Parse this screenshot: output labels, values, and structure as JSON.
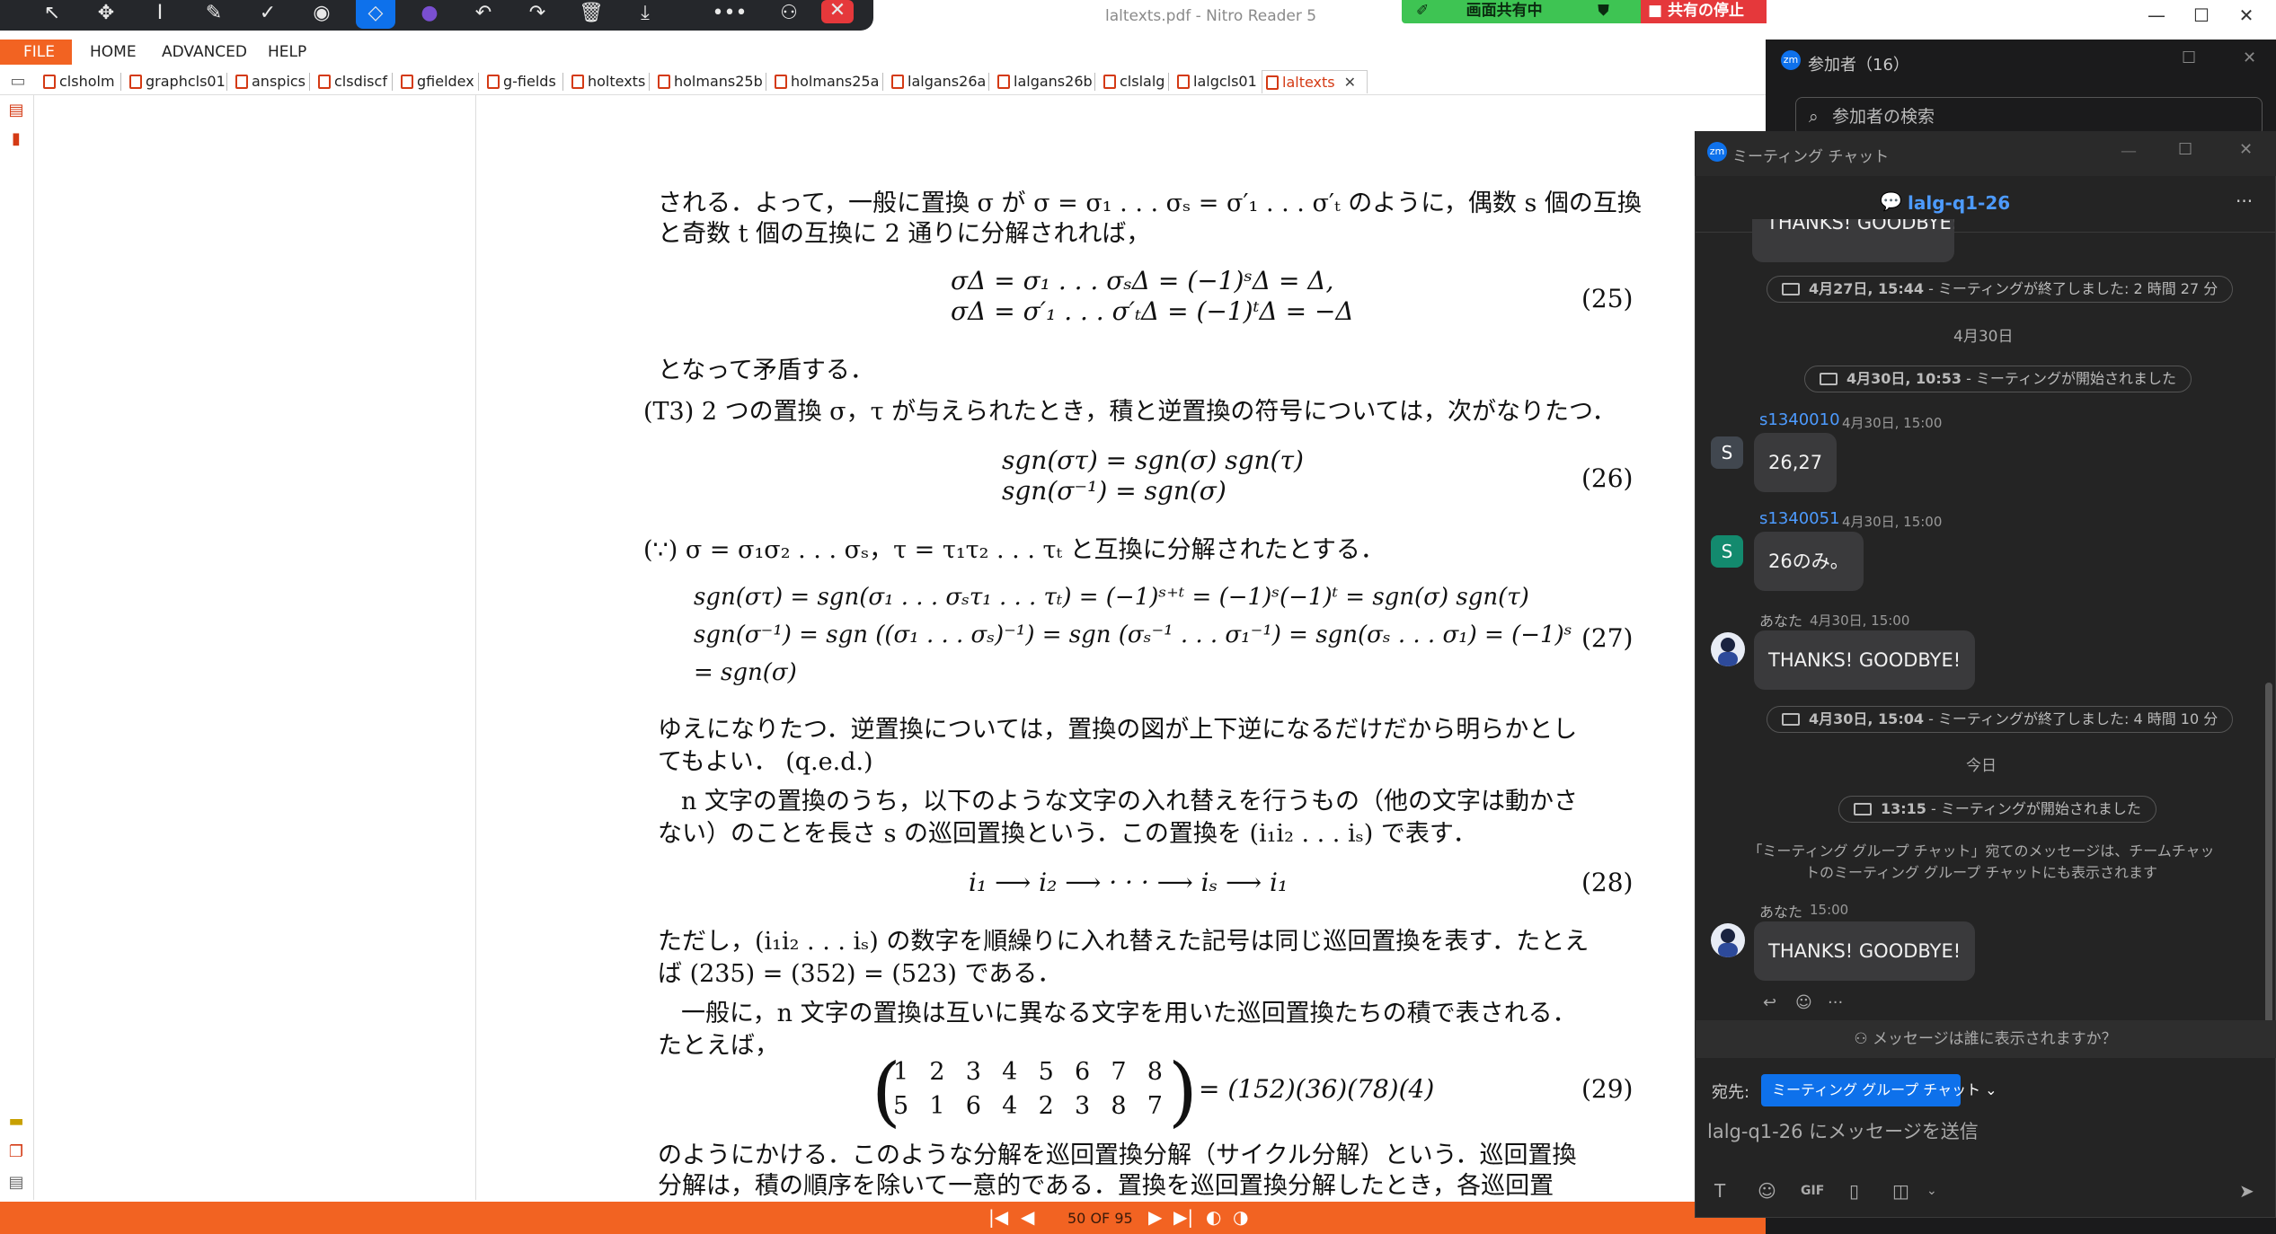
{
  "window": {
    "title": "laltexts.pdf - Nitro Reader 5",
    "minimize": "—",
    "maximize": "☐",
    "close": "✕"
  },
  "share_bar": {
    "label": "画面共有中",
    "stop_label": "共有の停止"
  },
  "menu": {
    "file": "FILE",
    "items": [
      "HOME",
      "ADVANCED",
      "HELP"
    ]
  },
  "tabs": [
    "clsholm",
    "graphcls01",
    "anspics",
    "clsdiscf",
    "gfieldex",
    "g-fields",
    "holtexts",
    "holmans25b",
    "holmans25a",
    "lalgans26a",
    "lalgans26b",
    "clslalg",
    "lalgcls01",
    "laltexts"
  ],
  "tab_close": "✕",
  "document": {
    "lines": [
      "される．よって，一般に置換 σ が σ = σ₁ . . . σₛ = σ′₁ . . . σ′ₜ のように，偶数 s 個の互換",
      "と奇数 t 個の互換に 2 通りに分解されれば，",
      "となって矛盾する．",
      "(T3)  2 つの置換 σ，τ が与えられたとき，積と逆置換の符号については，次がなりたつ．",
      "(∵)  σ = σ₁σ₂ . . . σₛ，τ = τ₁τ₂ . . . τₜ と互換に分解されたとする．",
      "ゆえになりたつ．逆置換については，置換の図が上下逆になるだけだから明らかとし",
      "てもよい．  (q.e.d.)",
      "n 文字の置換のうち，以下のような文字の入れ替えを行うもの（他の文字は動かさ",
      "ない）のことを長さ s の巡回置換という．この置換を (i₁i₂ . . . iₛ) で表す．",
      "ただし，(i₁i₂ . . . iₛ) の数字を順繰りに入れ替えた記号は同じ巡回置換を表す．たとえ",
      "ば (235) = (352) = (523) である．",
      "一般に，n 文字の置換は互いに異なる文字を用いた巡回置換たちの積で表される．",
      "たとえば，",
      "のようにかける．このような分解を巡回置換分解（サイクル分解）という．巡回置換",
      "分解は，積の順序を除いて一意的である．置換を巡回置換分解したとき，各巡回置"
    ],
    "equations": [
      "σΔ = σ₁ . . . σₛΔ = (−1)ˢΔ = Δ,",
      "σΔ = σ′₁ . . . σ′ₜΔ = (−1)ᵗΔ = −Δ",
      "sgn(στ) = sgn(σ) sgn(τ)",
      "sgn(σ⁻¹) = sgn(σ)",
      "sgn(στ) = sgn(σ₁ . . . σₛτ₁ . . . τₜ) = (−1)ˢ⁺ᵗ = (−1)ˢ(−1)ᵗ = sgn(σ) sgn(τ)",
      "sgn(σ⁻¹) = sgn ((σ₁ . . . σₛ)⁻¹) = sgn (σₛ⁻¹ . . . σ₁⁻¹) = sgn(σₛ . . . σ₁) = (−1)ˢ",
      "= sgn(σ)",
      "i₁ ⟶ i₂ ⟶ · · · ⟶ iₛ ⟶ i₁",
      "= (152)(36)(78)(4)"
    ],
    "matrix_top": [
      "1",
      "2",
      "3",
      "4",
      "5",
      "6",
      "7",
      "8"
    ],
    "matrix_bottom": [
      "5",
      "1",
      "6",
      "4",
      "2",
      "3",
      "8",
      "7"
    ],
    "eq_numbers": [
      "(25)",
      "(26)",
      "(27)",
      "(28)",
      "(29)"
    ]
  },
  "status": {
    "page": "50 OF 95"
  },
  "participants": {
    "title": "参加者（16）",
    "search_placeholder": "参加者の検索"
  },
  "chat": {
    "window_title": "ミーティング チャット",
    "name": "lalg-q1-26",
    "cut_message": "THANKS! GOODBYE!",
    "sys1_bold": "4月27日, 15:44",
    "sys1_text": " - ミーティングが終了しました: 2 時間 27 分",
    "date1": "4月30日",
    "sys2_bold": "4月30日, 10:53",
    "sys2_text": " - ミーティングが開始されました",
    "msg1_sender": "s1340010",
    "msg1_time": "4月30日, 15:00",
    "msg1_avatar": "S",
    "msg1_text": "26,27",
    "msg2_sender": "s1340051",
    "msg2_time": "4月30日, 15:00",
    "msg2_avatar": "S",
    "msg2_text": "26のみ。",
    "msg3_sender": "あなた",
    "msg3_time": "4月30日, 15:00",
    "msg3_text": "THANKS! GOODBYE!",
    "sys3_bold": "4月30日, 15:04",
    "sys3_text": " - ミーティングが終了しました: 4 時間 10 分",
    "date2": "今日",
    "sys4_bold": "13:15",
    "sys4_text": " - ミーティングが開始されました",
    "notice": "「ミーティング グループ チャット」宛てのメッセージは、チームチャットのミーティング グループ チャットにも表示されます",
    "msg4_sender": "あなた",
    "msg4_time": "15:00",
    "msg4_text": "THANKS! GOODBYE!",
    "visibility": "メッセージは誰に表示されますか？",
    "to_label": "宛先:",
    "to_value": "ミーティング グループ チャット ⌄",
    "input_placeholder": "lalg-q1-26 にメッセージを送信"
  },
  "colors": {
    "accent": "#f26322",
    "share_green": "#3ec453",
    "stop_red": "#e5383b",
    "zoom_blue": "#0e71eb"
  }
}
